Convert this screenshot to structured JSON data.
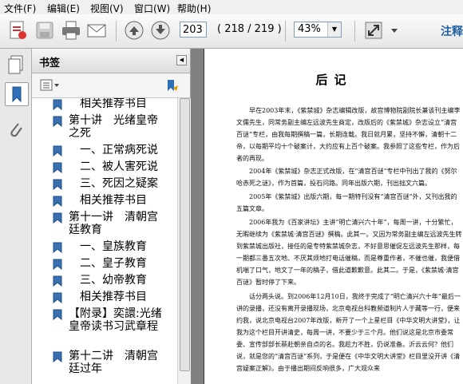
{
  "menu": {
    "items": [
      "文件(F)",
      "编辑(E)",
      "视图(V)",
      "窗口(W)",
      "帮助(H)"
    ]
  },
  "toolbar": {
    "page_value": "203",
    "page_count": "( 218 / 219 )",
    "zoom_value": "43%",
    "brand": "注释",
    "icons": [
      "create-pdf-icon",
      "save-icon",
      "print-icon",
      "email-icon",
      "page-up-icon",
      "page-down-icon",
      "fit-page-icon"
    ]
  },
  "sidebar": {
    "title": "书签",
    "bookmarks": [
      {
        "label": "相关推荐书目",
        "indent": true
      },
      {
        "label": "第十讲　光绪皇帝之死",
        "indent": false
      },
      {
        "label": "一、正常病死说",
        "indent": true
      },
      {
        "label": "二、被人害死说",
        "indent": true
      },
      {
        "label": "三、死因之疑案",
        "indent": true
      },
      {
        "label": "相关推荐书目",
        "indent": true
      },
      {
        "label": "第十一讲　清朝宫廷教育",
        "indent": false
      },
      {
        "label": "一、皇族教育",
        "indent": true
      },
      {
        "label": "二、皇子教育",
        "indent": true
      },
      {
        "label": "三、幼帝教育",
        "indent": true
      },
      {
        "label": "相关推荐书目",
        "indent": true
      },
      {
        "label": "【附录】奕譞:光绪皇帝读书习武章程",
        "indent": false
      },
      {
        "label": "第十二讲　清朝宫廷过年",
        "indent": false
      }
    ]
  },
  "document": {
    "title": "后记",
    "paragraphs": [
      "　　早在2003年末，《紫禁城》杂志编辑改版，故宫博物院副院长兼该刊主编李文儒先生，同常务副主编左远波先生商定，改版后的《紫禁城》杂志设立“清宫百谜”专栏，由我每期撰稿一篇，长期连载。我日就月累，坚持不懈，清朝十二帝，以每期平均十个破案计，大约应有上百个破案。我参照了这些专栏，作为后者的再现。",
      "　　2004年《紫禁城》杂志正式改版，在“清宫百谜”专栏中刊出了我的《努尔哈赤死之谜》，作为首篇，投石问路。同年出版六期，刊出拙文六篇。",
      "　　2005年《紫禁城》出版六期，每一期特刊没有“清宫百谜”外，又刊出我的五篇文章。",
      "　　2006年我为《百家讲坛》主讲“明亡清兴六十年”，每周一讲，十分繁忙，无暇继续为《紫禁城·清宫百谜》撰稿。此其一。又因为常务副主编左远波先生转到紫禁城出版社，接任的是专特紫禁城杂志，不好意思催促左远波先生那样，每一期都三番五次地、不厌其烦地打电话催稿，而是尊重作者，不催也催，我便借机喘了口气，地文了一年的稿子，借此道歉歉意。此其二。于是，《紫禁城·清宫百谜》暂时停了下来。",
      "　　话分两头说。到2006年12月10日，我终于完成了“明亡清兴六十年”最后一讲的录播，还没有离开录播现场，北京电视台科教频道制片人于藏等一行，便来约我，说北京电视台2007年改版，新开了一个上星栏目《中华文明大讲堂》，让我为这个栏目开讲清史，每周一讲，不要少于三个月。他们说这是北京市委常委、宣传部部长蔡赴朝亲自点的名。我趁力不胜，仍说准备。沂云云何？他们说，就是您的“清宫百谜”系列，于是便在《中华文明大讲堂》栏目里没开讲《清宫疑案正解》。由于播出期间反响很多，广大观众来"
    ]
  }
}
